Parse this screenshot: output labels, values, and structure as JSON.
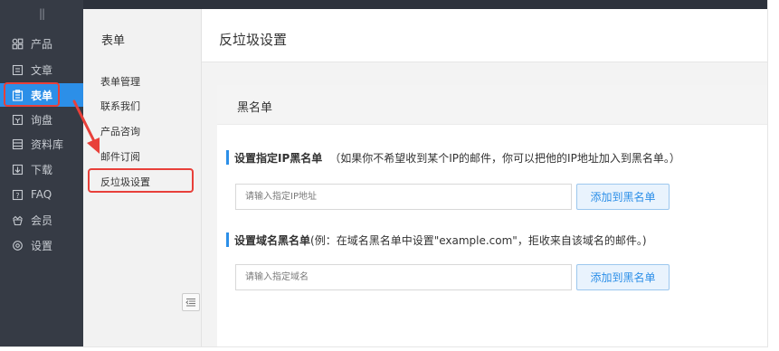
{
  "sidebar": {
    "handle": "||",
    "items": [
      {
        "label": "产品",
        "icon": "grid-icon"
      },
      {
        "label": "文章",
        "icon": "document-icon"
      },
      {
        "label": "表单",
        "icon": "form-icon"
      },
      {
        "label": "询盘",
        "icon": "inquiry-icon"
      },
      {
        "label": "资料库",
        "icon": "library-icon"
      },
      {
        "label": "下载",
        "icon": "download-icon"
      },
      {
        "label": "FAQ",
        "icon": "faq-icon"
      },
      {
        "label": "会员",
        "icon": "member-icon"
      },
      {
        "label": "设置",
        "icon": "settings-icon"
      }
    ],
    "active_index": 2
  },
  "subbar": {
    "title": "表单",
    "items": [
      "表单管理",
      "联系我们",
      "产品咨询",
      "邮件订阅",
      "反垃圾设置"
    ]
  },
  "page": {
    "title": "反垃圾设置"
  },
  "card": {
    "title": "黑名单",
    "ip_section": {
      "label_bold": "设置指定IP黑名单",
      "label_note": "（如果你不希望收到某个IP的邮件，你可以把他的IP地址加入到黑名单。）",
      "placeholder": "请输入指定IP地址",
      "button": "添加到黑名单"
    },
    "domain_section": {
      "label_bold": "设置域名黑名单",
      "label_note": "(例：在域名黑名单中设置\"example.com\"，拒收来自该域名的邮件。)",
      "placeholder": "请输入指定域名",
      "button": "添加到黑名单"
    }
  },
  "colors": {
    "accent": "#2c8fe8",
    "annotation": "#e8403a",
    "sidebar_bg": "#363b45"
  }
}
